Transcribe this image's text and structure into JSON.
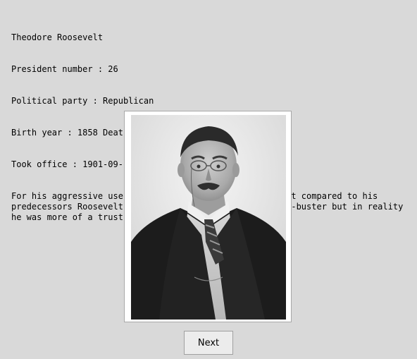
{
  "president": {
    "name": "Theodore Roosevelt",
    "number_line": "President number : 26",
    "party_line": "Political party : Republican",
    "years_line": "Birth year : 1858 Death year : 1919",
    "office_line": "Took office : 1901-09-14 Left office : 1909-03-04",
    "description": "For his aggressive use of the 1890 Sherman Antitrust Act compared to his predecessors Roosevelt became mythologized as the trust-buster but in reality he was more of a trust regulator."
  },
  "controls": {
    "next_label": "Next"
  }
}
